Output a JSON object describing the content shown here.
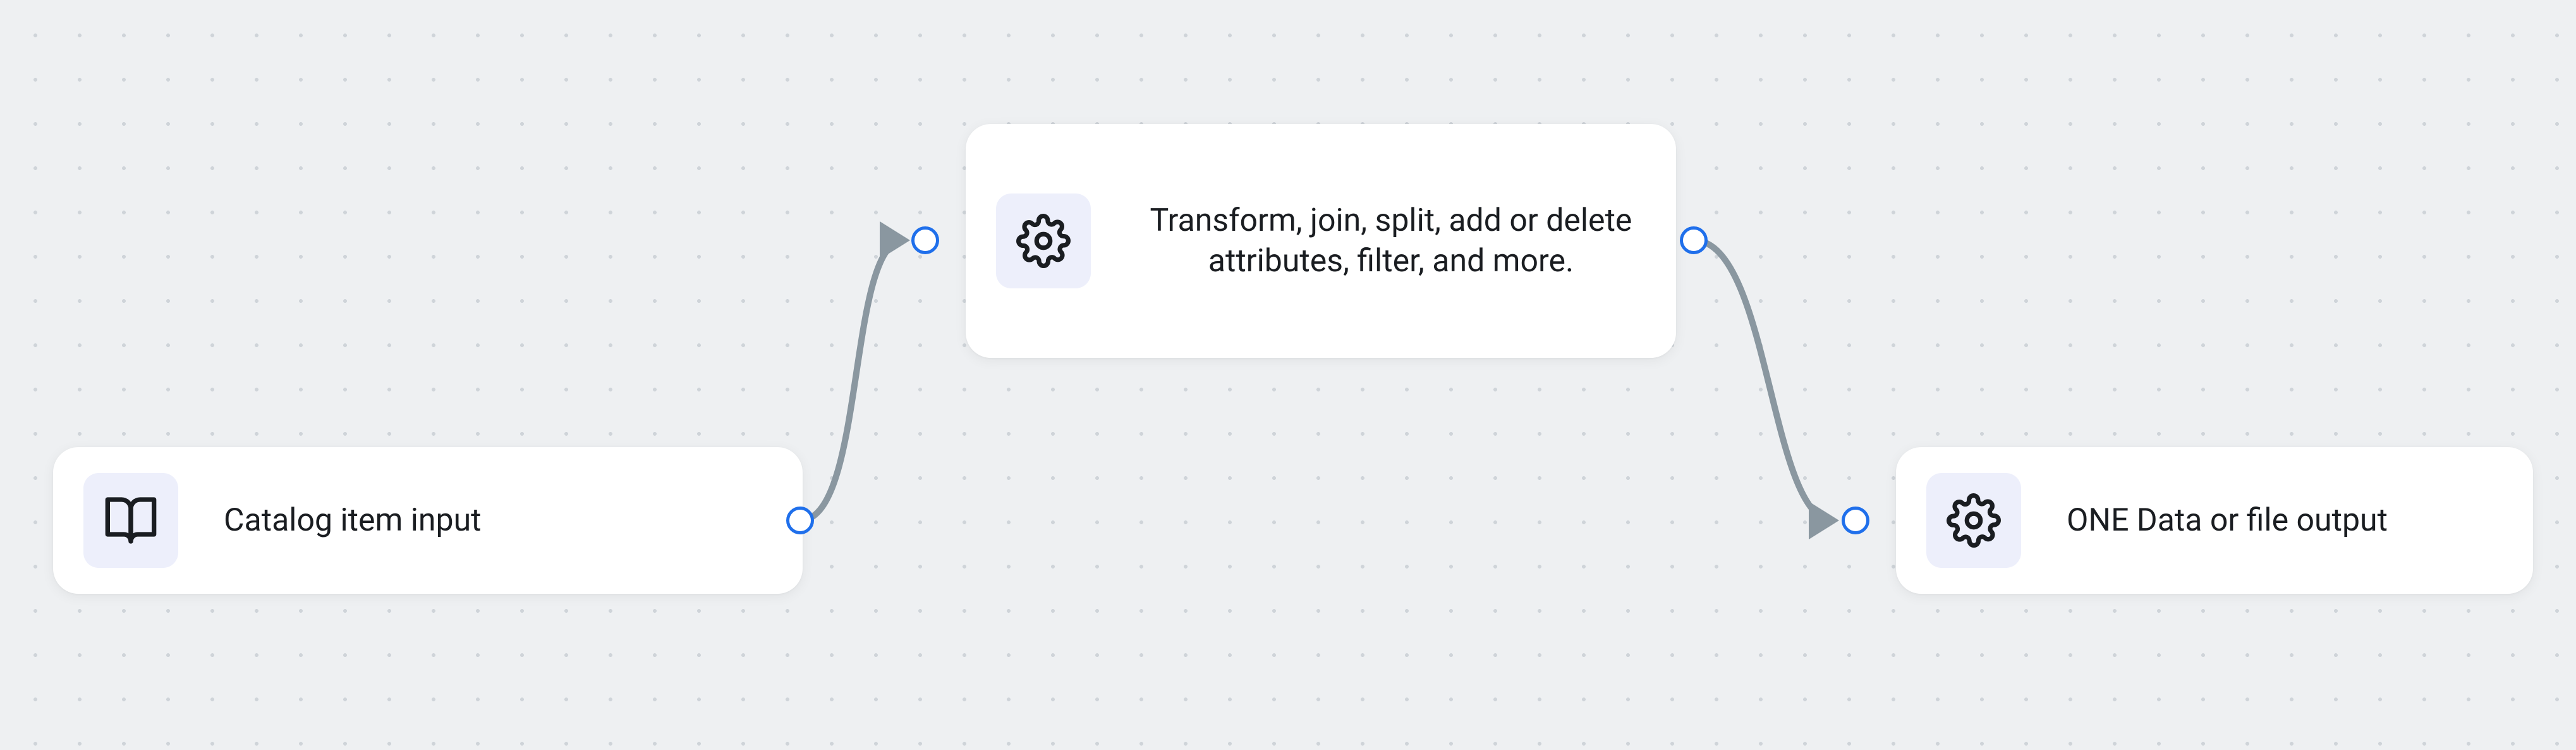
{
  "nodes": {
    "input": {
      "label": "Catalog item input",
      "icon": "book-open-icon"
    },
    "transform": {
      "label": "Transform, join, split, add or delete attributes, filter, and more.",
      "icon": "gear-icon"
    },
    "output": {
      "label": "ONE Data or file output",
      "icon": "gear-icon"
    }
  },
  "colors": {
    "canvas_bg": "#eef0f2",
    "dot": "#cfd4d9",
    "node_bg": "#ffffff",
    "icon_box_bg": "#edeffb",
    "port_border": "#1f6feb",
    "edge": "#8a97a0",
    "text": "#1a1d21"
  }
}
